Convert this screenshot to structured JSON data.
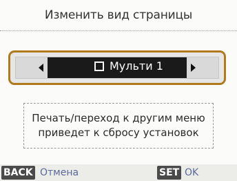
{
  "title": "Изменить вид страницы",
  "selector": {
    "value": "Мульти 1",
    "icon": "page-layout-icon"
  },
  "notice": {
    "line1": "Печать/переход к другим меню",
    "line2": "приведет к сбросу установок"
  },
  "footer": {
    "back_key": "BACK",
    "back_label": "Отмена",
    "set_key": "SET",
    "set_label": "OK"
  },
  "colors": {
    "selector_border": "#b07a1c",
    "selected_value_bg": "#1a1a1a",
    "footer_label": "#5a6a9a"
  }
}
